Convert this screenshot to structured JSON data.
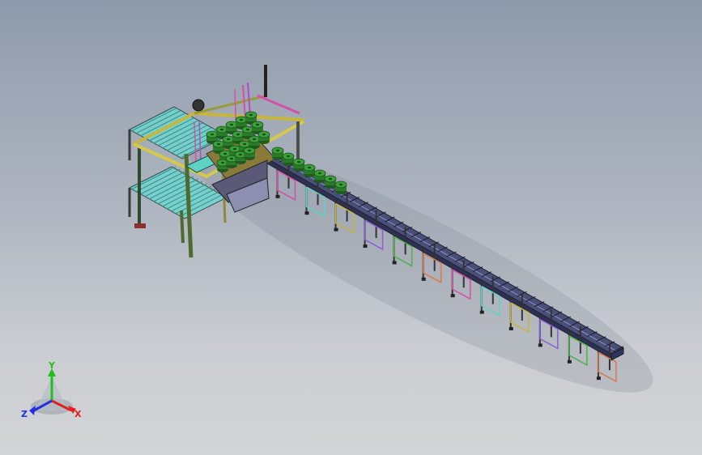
{
  "triad": {
    "x_label": "X",
    "y_label": "Y",
    "z_label": "Z",
    "colors": {
      "x": "#e02020",
      "y": "#20c020",
      "z": "#2030e0"
    }
  },
  "model": {
    "description_icon": "assembly-model",
    "background": [
      "#8f9aab",
      "#d3d4d6"
    ]
  }
}
